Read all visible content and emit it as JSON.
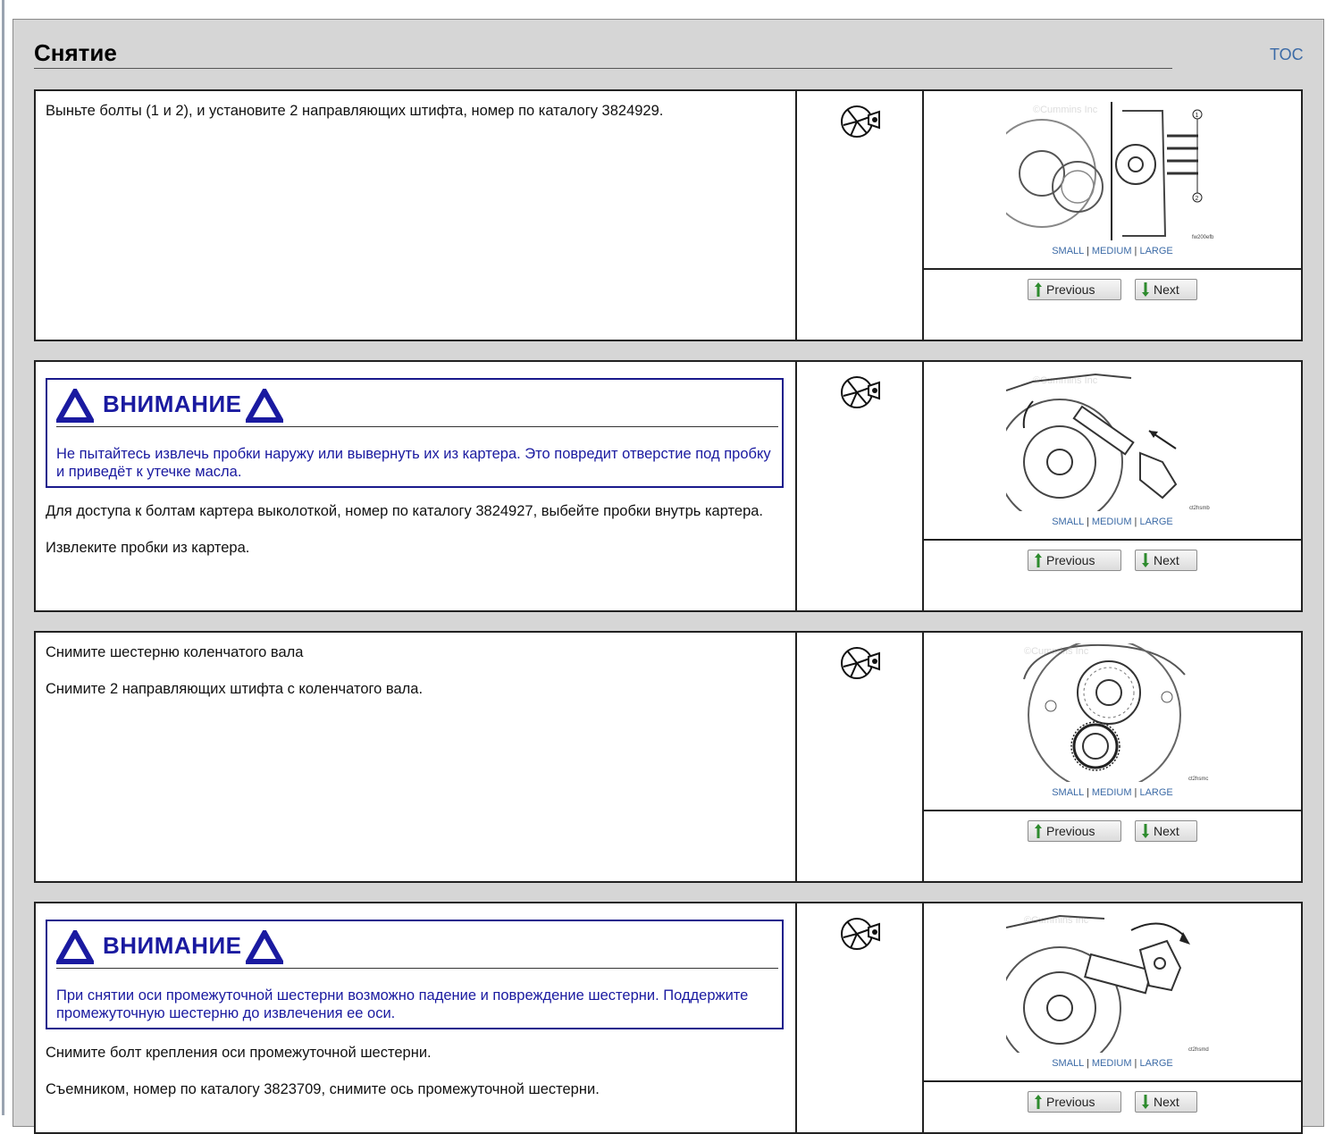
{
  "page": {
    "title": "Снятие",
    "toc_label": "TOC"
  },
  "common": {
    "size_small": "SMALL",
    "size_medium": "MEDIUM",
    "size_large": "LARGE",
    "size_sep": "|",
    "prev_label": "Previous",
    "next_label": "Next",
    "warning_title": "ВНИМАНИЕ",
    "tool_icon": "tool-wrench-icon"
  },
  "steps": [
    {
      "paragraphs": [
        "Выньте болты (1 и 2), и установите 2 направляющих штифта, номер по каталогу 3824929."
      ],
      "figure_caption": "fw200efb",
      "figure_watermark": "©Cummins Inc"
    },
    {
      "warning": "Не пытайтесь извлечь пробки наружу или вывернуть их из картера. Это повредит отверстие под пробку и приведёт к утечке масла.",
      "paragraphs": [
        "Для доступа к болтам картера выколоткой, номер по каталогу 3824927, выбейте пробки внутрь картера.",
        "Извлеките пробки из картера."
      ],
      "figure_caption": "ct2hsmb",
      "figure_watermark": "©Cummins Inc"
    },
    {
      "paragraphs": [
        "Снимите шестерню коленчатого вала",
        "Снимите 2 направляющих штифта с коленчатого вала."
      ],
      "figure_caption": "ct2hsmc",
      "figure_watermark": "©Cummins Inc"
    },
    {
      "warning": "При снятии оси промежуточной шестерни возможно падение и повреждение шестерни. Поддержите промежуточную шестерню до извлечения ее оси.",
      "paragraphs": [
        "Снимите болт крепления оси промежуточной шестерни.",
        "Съемником, номер по каталогу 3823709, снимите ось промежуточной шестерни."
      ],
      "figure_caption": "ct2hsmd",
      "figure_watermark": "©Cummins Inc"
    }
  ]
}
